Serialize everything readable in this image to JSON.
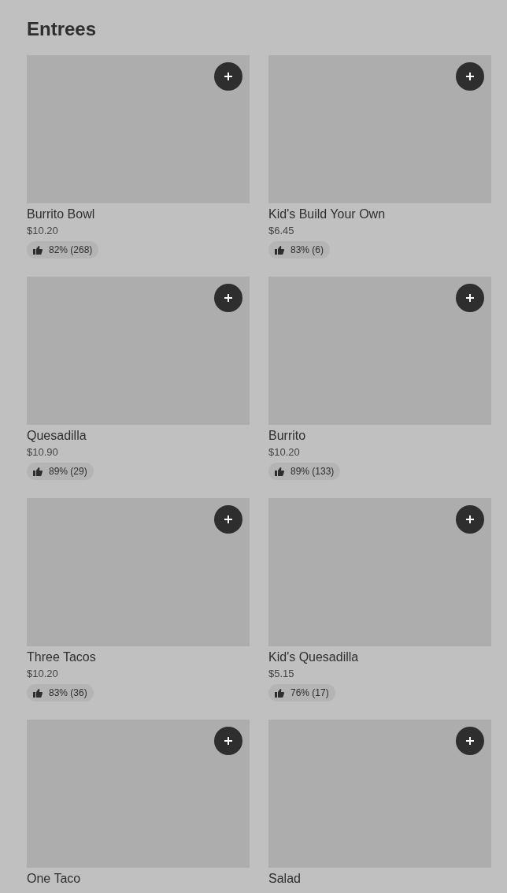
{
  "section_title": "Entrees",
  "items": [
    {
      "name": "Burrito Bowl",
      "price": "$10.20",
      "rating": "82% (268)"
    },
    {
      "name": "Kid's Build Your Own",
      "price": "$6.45",
      "rating": "83% (6)"
    },
    {
      "name": "Quesadilla",
      "price": "$10.90",
      "rating": "89% (29)"
    },
    {
      "name": "Burrito",
      "price": "$10.20",
      "rating": "89% (133)"
    },
    {
      "name": "Three Tacos",
      "price": "$10.20",
      "rating": "83% (36)"
    },
    {
      "name": "Kid's Quesadilla",
      "price": "$5.15",
      "rating": "76% (17)"
    },
    {
      "name": "One Taco"
    },
    {
      "name": "Salad"
    }
  ]
}
